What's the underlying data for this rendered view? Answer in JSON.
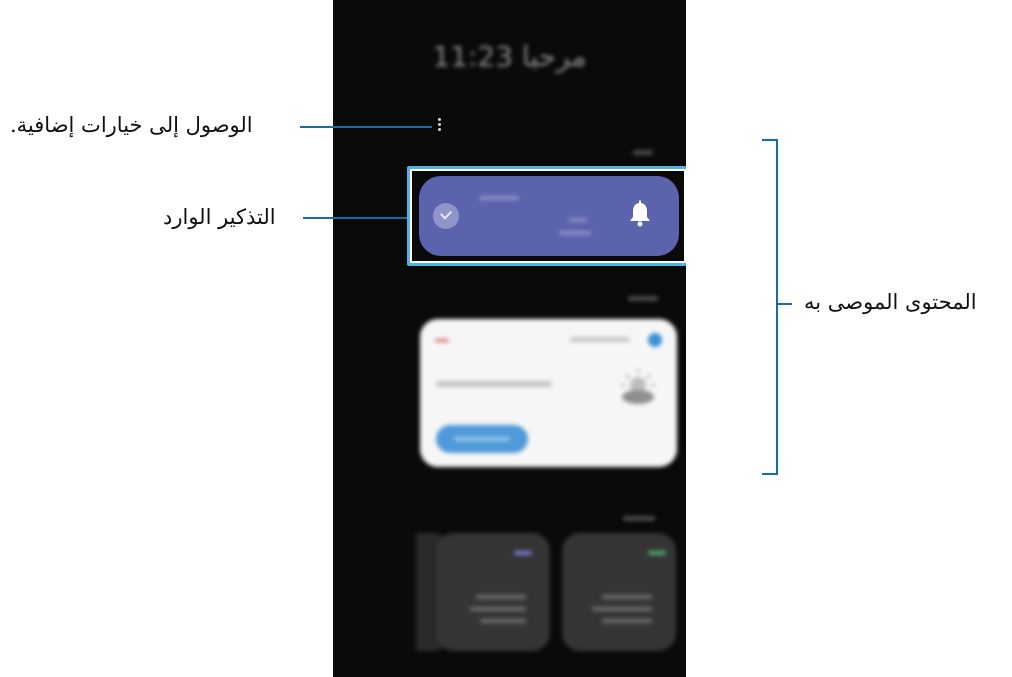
{
  "screen": {
    "greeting": "مرحبا 11:23"
  },
  "callouts": {
    "more_options": "الوصول إلى خيارات إضافية.",
    "incoming_reminder": "التذكير الوارد",
    "recommended_content": "المحتوى الموصى به"
  },
  "colors": {
    "callout_line": "#1a6aa8",
    "highlight_frame": "#4fb3e0",
    "reminder_card": "#5b63ad",
    "weather_button": "#4f9ad9"
  },
  "icons": {
    "more": "more-options-icon",
    "reminder_check": "check-circle-icon",
    "reminder_bell": "bell-icon",
    "weather_app": "weather-app-icon",
    "weather_condition": "sun-cloud-icon"
  }
}
